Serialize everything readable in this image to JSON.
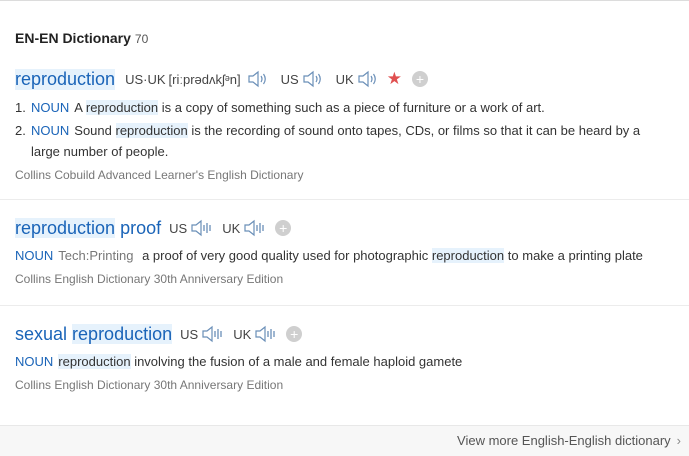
{
  "section": {
    "title": "EN-EN Dictionary",
    "count": "70"
  },
  "entries": [
    {
      "headword": "reproduction",
      "pron": {
        "usuk_label": "US·UK",
        "ipa": "[riːprədʌkʃᵊn]",
        "us_label": "US",
        "uk_label": "UK"
      },
      "senses": [
        {
          "num": "1.",
          "pos": "NOUN",
          "a": "A",
          "hl": "reproduction",
          "b": "is a copy of something such as a piece of furniture or a work of art."
        },
        {
          "num": "2.",
          "pos": "NOUN",
          "a": "Sound",
          "hl": "reproduction",
          "b": "is the recording of sound onto tapes, CDs, or films so that it can be heard by a",
          "c": "large number of people."
        }
      ],
      "source": "Collins Cobuild Advanced Learner's English Dictionary"
    },
    {
      "headword_hl": "reproduction",
      "headword_rest": "proof",
      "pron": {
        "us_label": "US",
        "uk_label": "UK"
      },
      "sense": {
        "pos": "NOUN",
        "domain": "Tech:Printing",
        "a": "a proof of very good quality used for photographic",
        "hl": "reproduction",
        "b": "to make a printing plate"
      },
      "source": "Collins English Dictionary 30th Anniversary Edition"
    },
    {
      "headword_pre": "sexual",
      "headword_hl": "reproduction",
      "pron": {
        "us_label": "US",
        "uk_label": "UK"
      },
      "sense": {
        "pos": "NOUN",
        "hl": "reproduction",
        "b": "involving the fusion of a male and female haploid gamete"
      },
      "source": "Collins English Dictionary 30th Anniversary Edition"
    }
  ],
  "footer": {
    "more_label": "View more English-English dictionary",
    "chevron": "›"
  },
  "icons": {
    "star": "★",
    "add": "+"
  },
  "colors": {
    "link": "#1a64b8",
    "highlight": "#e6f2fc",
    "star": "#e05050"
  }
}
